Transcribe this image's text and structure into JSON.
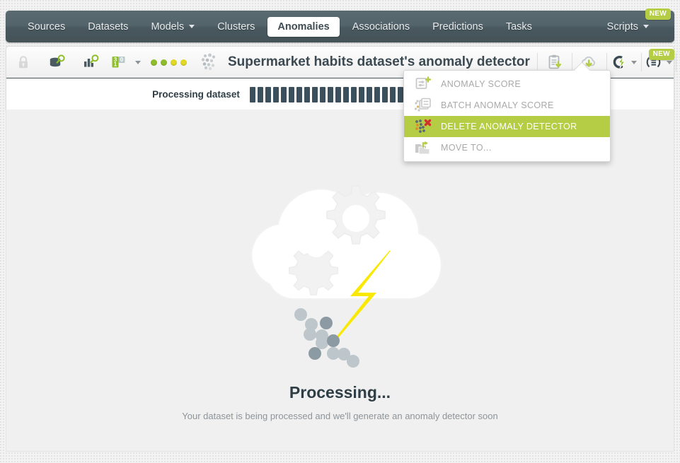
{
  "nav": {
    "items": [
      {
        "label": "Sources",
        "dropdown": false,
        "active": false
      },
      {
        "label": "Datasets",
        "dropdown": false,
        "active": false
      },
      {
        "label": "Models",
        "dropdown": true,
        "active": false
      },
      {
        "label": "Clusters",
        "dropdown": false,
        "active": false
      },
      {
        "label": "Anomalies",
        "dropdown": false,
        "active": true
      },
      {
        "label": "Associations",
        "dropdown": false,
        "active": false
      },
      {
        "label": "Predictions",
        "dropdown": false,
        "active": false
      },
      {
        "label": "Tasks",
        "dropdown": false,
        "active": false
      }
    ],
    "scripts_label": "Scripts",
    "scripts_badge": "NEW"
  },
  "toolbar": {
    "title": "Supermarket habits dataset's anomaly detector",
    "lock_icon": "lock-icon",
    "dataset_search_icon": "dataset-search-icon",
    "model_search_icon": "chart-search-icon",
    "sample_icon": "sample-size-icon",
    "status_dots": [
      "#8dbd2b",
      "#8dbd2b",
      "#e0d824",
      "#e0d824"
    ],
    "anomaly_icon": "anomaly-scatter-icon",
    "clipboard_icon": "clipboard-download-icon",
    "cloud_icon": "cloud-download-icon",
    "actions_icon": "actions-lightning-icon",
    "list_icon": "list-view-icon",
    "info_icon": "info-icon",
    "list_badge": "NEW"
  },
  "progress": {
    "label": "Processing dataset",
    "total_segments": 36,
    "filled_segments": 20,
    "percent": 56
  },
  "menu": {
    "items": [
      {
        "label": "ANOMALY SCORE",
        "icon": "anomaly-score-icon",
        "active": false
      },
      {
        "label": "BATCH ANOMALY SCORE",
        "icon": "batch-anomaly-score-icon",
        "active": false
      },
      {
        "label": "DELETE ANOMALY DETECTOR",
        "icon": "delete-anomaly-icon",
        "active": true
      },
      {
        "label": "MOVE TO...",
        "icon": "move-to-folder-icon",
        "active": false
      }
    ]
  },
  "content": {
    "illustration": "cloud-gears-lightning-icon",
    "headline": "Processing...",
    "subline": "Your dataset is being processed and we'll generate an anomaly detector soon"
  },
  "colors": {
    "accent_green": "#b5cc45",
    "nav_dark": "#4c5b62",
    "title_text": "#3b4a52",
    "lightning_yellow": "#f9e900"
  }
}
